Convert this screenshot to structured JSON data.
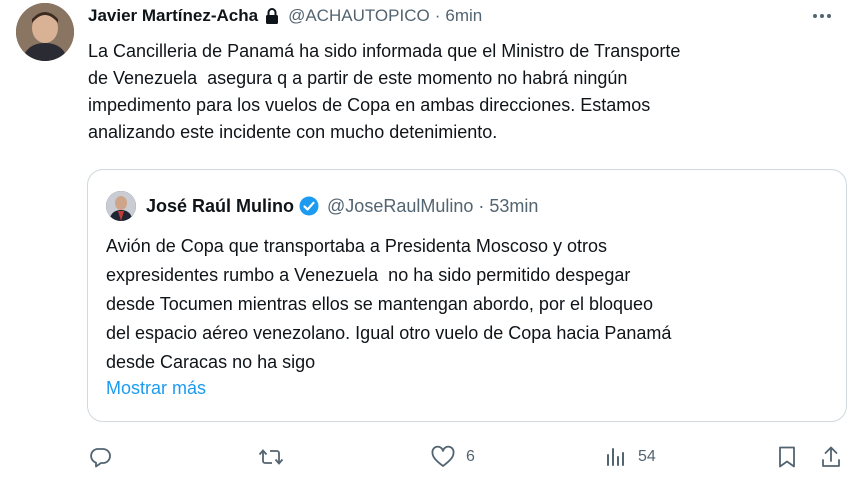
{
  "tweet": {
    "author_name": "Javier Martínez-Acha",
    "handle": "@ACHAUTOPICO",
    "separator": "·",
    "time": "6min",
    "text": "La Cancilleria de Panamá ha sido informada que el Ministro de Transporte\nde Venezuela  asegura q a partir de este momento no habrá ningún\nimpedimento para los vuelos de Copa en ambas direcciones. Estamos\nanalizando este incidente con mucho detenimiento."
  },
  "quoted": {
    "author_name": "José Raúl Mulino",
    "handle": "@JoseRaulMulino",
    "separator": "·",
    "time": "53min",
    "text": "Avión de Copa que transportaba a Presidenta Moscoso y otros\nexpresidentes rumbo a Venezuela  no ha sido permitido despegar\ndesde Tocumen mientras ellos se mantengan abordo, por el bloqueo\ndel espacio aéreo venezolano. Igual otro vuelo de Copa hacia Panamá\ndesde Caracas no ha sigo",
    "show_more": "Mostrar más"
  },
  "actions": {
    "reply_count": "",
    "retweet_count": "",
    "like_count": "6",
    "views_count": "54"
  },
  "colors": {
    "text": "#0f1419",
    "secondary": "#536471",
    "link": "#1d9bf0",
    "border": "#cfd9de"
  },
  "icons": [
    "lock-icon",
    "more-icon",
    "verified-badge-icon",
    "reply-icon",
    "retweet-icon",
    "like-icon",
    "views-icon",
    "bookmark-icon",
    "share-icon"
  ]
}
